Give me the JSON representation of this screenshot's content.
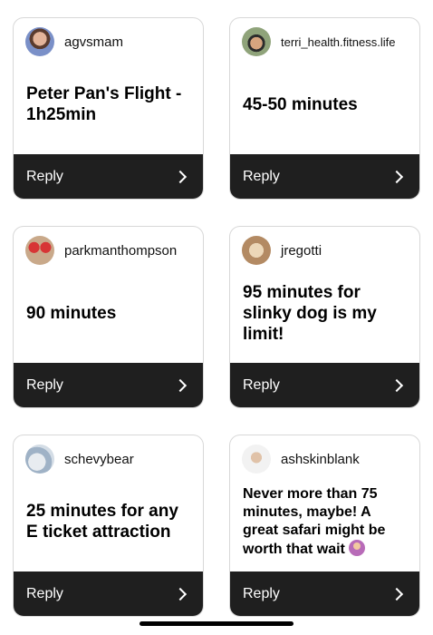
{
  "cards": [
    {
      "username": "agvsmam",
      "message": "Peter Pan's Flight - 1h25min",
      "reply": "Reply"
    },
    {
      "username": "terri_health.fitness.life",
      "message": "45-50 minutes",
      "reply": "Reply"
    },
    {
      "username": "parkmanthompson",
      "message": "90 minutes",
      "reply": "Reply"
    },
    {
      "username": "jregotti",
      "message": "95 minutes for slinky dog is my limit!",
      "reply": "Reply"
    },
    {
      "username": "schevybear",
      "message": "25 minutes for any E ticket attraction",
      "reply": "Reply"
    },
    {
      "username": "ashskinblank",
      "message": "Never more than 75 minutes, maybe! A great safari might be worth that wait",
      "reply": "Reply"
    }
  ],
  "icons": {
    "chevron": "chevron-right-icon",
    "emoji": "person-shrugging-emoji"
  },
  "colors": {
    "reply_bar": "#1f1f1f",
    "card_border": "#d8d8d8",
    "text": "#000000"
  }
}
